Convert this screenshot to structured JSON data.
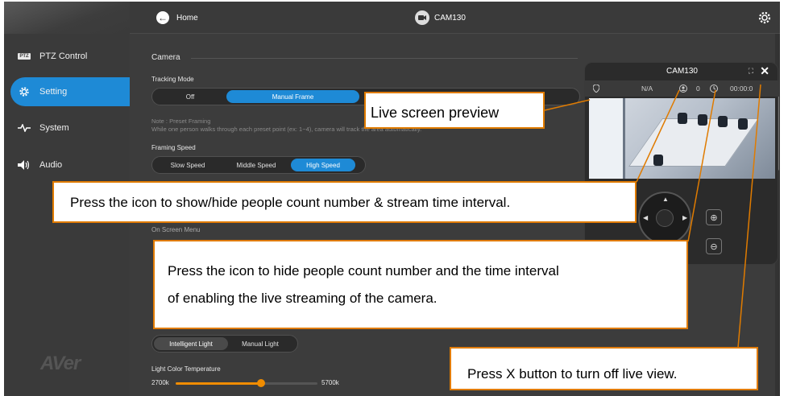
{
  "topbar": {
    "home_label": "Home",
    "camera_name": "CAM130"
  },
  "sidebar": {
    "items": [
      {
        "label": "PTZ Control",
        "badge": "PTZ"
      },
      {
        "label": "Setting"
      },
      {
        "label": "System"
      },
      {
        "label": "Audio"
      }
    ],
    "logo": "AVer"
  },
  "main": {
    "section_title": "Camera",
    "tracking_mode_label": "Tracking Mode",
    "tracking_options": [
      "Off",
      "Manual Frame"
    ],
    "note_line1": "Note : Preset Framing",
    "note_line2": "While one person walks through each preset point (ex: 1~4), camera will track the area automatically.",
    "framing_speed_label": "Framing Speed",
    "framing_speed_options": [
      "Slow Speed",
      "Middle Speed",
      "High Speed"
    ],
    "osd_label": "On Screen Menu",
    "fill_light_options": [
      "Intelligent Light",
      "Manual Light"
    ],
    "light_color_label": "Light Color Temperature",
    "light_min": "2700k",
    "light_max": "5700k",
    "light_level_fraction": 0.6
  },
  "preview": {
    "title": "CAM130",
    "location": "N/A",
    "people_count": "0",
    "stream_time": "00:00:0"
  },
  "callouts": {
    "live_preview": "Live screen preview",
    "show_hide": "Press the icon to show/hide people count number & stream time interval.",
    "hide_line1": "Press the icon to hide people count number and the time interval",
    "hide_line2": "of enabling the live streaming of the camera.",
    "close": "Press X button to turn off live view."
  },
  "colors": {
    "accent": "#1e8ad6",
    "callout_border": "#e07b00",
    "slider": "#f08c00"
  }
}
